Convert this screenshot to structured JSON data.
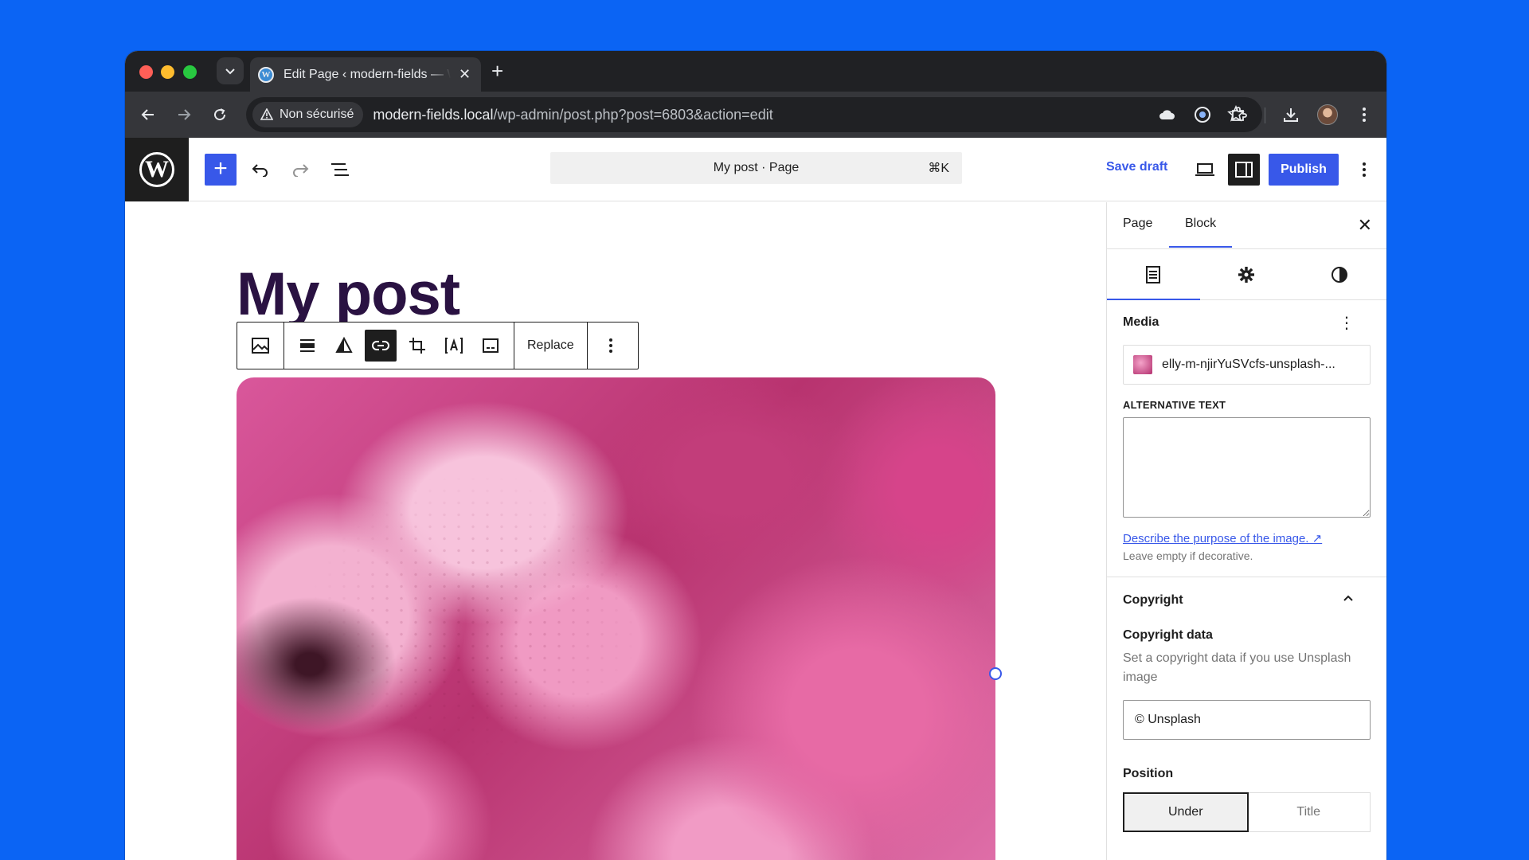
{
  "browser": {
    "tab_title": "Edit Page ‹ modern-fields — WordPress",
    "security_label": "Non sécurisé",
    "url_host": "modern-fields.local",
    "url_path": "/wp-admin/post.php?post=6803&action=edit"
  },
  "editor": {
    "command_label": "My post · Page",
    "command_shortcut": "⌘K",
    "save_draft_label": "Save draft",
    "publish_label": "Publish",
    "post_title": "My post",
    "replace_label": "Replace"
  },
  "sidebar": {
    "tab_page": "Page",
    "tab_block": "Block",
    "media_heading": "Media",
    "media_filename": "elly-m-njirYuSVcfs-unsplash-...",
    "alt_label": "Alternative text",
    "alt_value": "",
    "alt_help_link": "Describe the purpose of the image. ↗",
    "alt_help_text": "Leave empty if decorative.",
    "copyright_heading": "Copyright",
    "copyright_field_title": "Copyright data",
    "copyright_field_help": "Set a copyright data if you use Unsplash image",
    "copyright_value": "© Unsplash",
    "position_label": "Position",
    "position_options": [
      "Under",
      "Title"
    ],
    "position_selected": "Under"
  },
  "colors": {
    "wp_blue": "#3858e9",
    "background": "#0b64f4",
    "title_color": "#2a1242"
  }
}
